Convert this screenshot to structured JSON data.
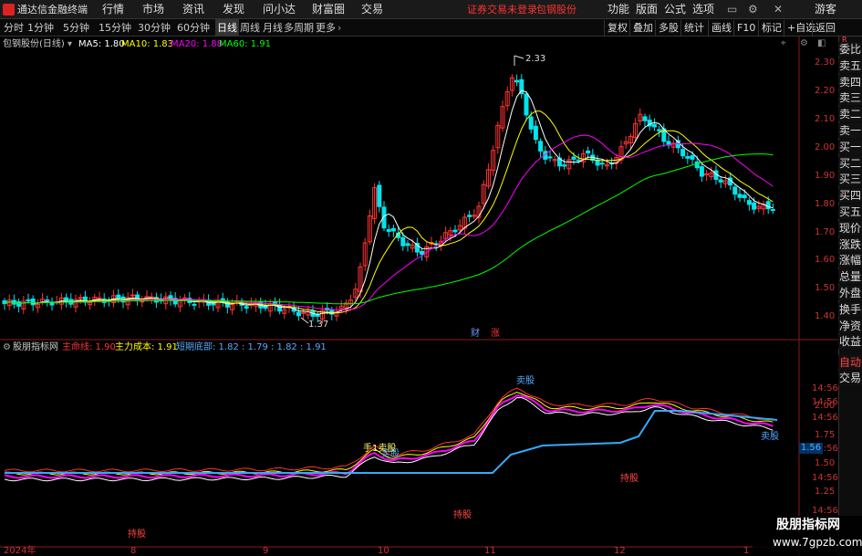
{
  "app": {
    "title": "通达信金融终端",
    "status_red": "证券交易未登录",
    "stock_red": "包钢股份",
    "guest": "游客"
  },
  "menus": [
    "行情",
    "市场",
    "资讯",
    "发现",
    "问小达",
    "财富圈",
    "交易"
  ],
  "title_buttons": [
    "功能",
    "版面",
    "公式",
    "选项"
  ],
  "period_tabs": [
    "分时",
    "1分钟",
    "5分钟",
    "15分钟",
    "30分钟",
    "60分钟",
    "日线",
    "周线",
    "月线",
    "多周期",
    "更多"
  ],
  "active_period": "日线",
  "right_buttons": [
    "复权",
    "叠加",
    "多股",
    "统计",
    "画线",
    "F10",
    "标记",
    "+自选",
    "返回"
  ],
  "main_chart": {
    "name": "包钢股份(日线)",
    "ma": [
      {
        "label": "MA5: 1.80",
        "color": "#ffffff"
      },
      {
        "label": "MA10: 1.83",
        "color": "#ffff00"
      },
      {
        "label": "MA20: 1.88",
        "color": "#ff00ff"
      },
      {
        "label": "MA60: 1.91",
        "color": "#00ff00"
      }
    ],
    "y_ticks": [
      "2.30",
      "2.20",
      "2.10",
      "2.00",
      "1.90",
      "1.80",
      "1.70",
      "1.60",
      "1.50",
      "1.40"
    ],
    "high_label": "2.33",
    "low_label": "1.37",
    "markers": [
      {
        "text": "财",
        "color": "#6699ff"
      },
      {
        "text": "涨",
        "color": "#ff3333"
      }
    ]
  },
  "indicator": {
    "name": "股朋指标网",
    "items": [
      {
        "label": "主命线: 1.90",
        "color": "#ff3333"
      },
      {
        "label": "主力成本: 1.91",
        "color": "#ffff00"
      },
      {
        "label": "短期底部: 1.82 : 1.79 : 1.82 : 1.91",
        "color": "#55aaff"
      }
    ],
    "y_ticks": [
      "14:56",
      "14:56",
      "14:56",
      "2.00",
      "1.75",
      "14:56",
      "1.50",
      "14:56",
      "1.25",
      "14:56"
    ],
    "value_tag": "1.56",
    "annotations": [
      {
        "text": "卖股",
        "color": "#55aaff"
      },
      {
        "text": "卖股",
        "color": "#55aaff"
      },
      {
        "text": "手1卖股",
        "color": "#ffff66"
      },
      {
        "text": "持股",
        "color": "#ff4444"
      },
      {
        "text": "持股",
        "color": "#ff4444"
      },
      {
        "text": "持股",
        "color": "#ff4444"
      },
      {
        "text": "卖股",
        "color": "#55aaff"
      }
    ]
  },
  "x_axis": [
    "2024年",
    "8",
    "9",
    "10",
    "11",
    "12",
    "1"
  ],
  "side_panel": {
    "scale": [
      "R",
      "300"
    ],
    "rows": [
      "委比",
      "卖五",
      "卖四",
      "卖三",
      "卖二",
      "卖一",
      "买一",
      "买二",
      "买三",
      "买四",
      "买五",
      "现价",
      "涨跌",
      "涨幅",
      "总量",
      "外盘",
      "换手",
      "净资",
      "收益"
    ],
    "auto": "自动",
    "trade": "交易"
  },
  "watermark": {
    "title": "股朋指标网",
    "url": "www.7gpzb.com"
  }
}
